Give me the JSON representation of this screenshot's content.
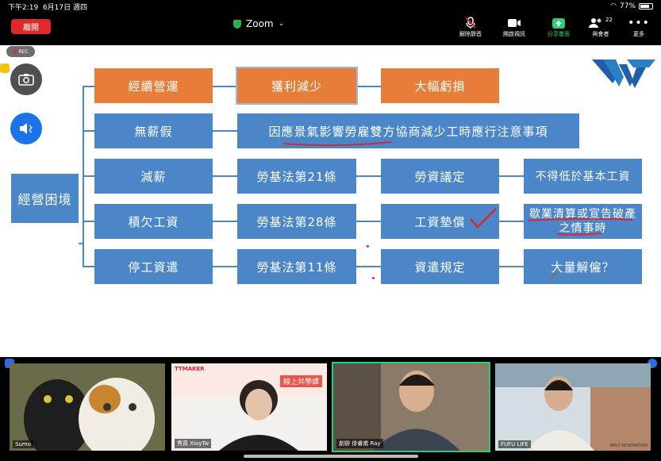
{
  "status_bar": {
    "time": "下午2:19",
    "date": "6月17日 週四",
    "battery": "77%"
  },
  "toolbar": {
    "leave_label": "離開",
    "title": "Zoom",
    "unmute_label": "解除靜音",
    "video_label": "開啟視訊",
    "share_label": "分享畫面",
    "participants_label": "與會者",
    "participants_count": "22",
    "more_label": "更多"
  },
  "side": {
    "rec_label": "REC",
    "camera_label": "切換攝影機",
    "bt_label": "藍牙"
  },
  "slide": {
    "root": "經營困境",
    "rows": [
      {
        "c1": "經續營運",
        "c2": "獲利減少",
        "c3": "大幅虧損"
      },
      {
        "c1": "無薪假",
        "c2": "因應景氣影響勞雇雙方協商減少工時應行注意事項"
      },
      {
        "c1": "減薪",
        "c2": "勞基法第21條",
        "c3": "勞資議定",
        "c4": "不得低於基本工資"
      },
      {
        "c1": "積欠工資",
        "c2": "勞基法第28條",
        "c3": "工資墊償",
        "c4a": "歇業清算或宣告破產",
        "c4b": "之情事時"
      },
      {
        "c1": "停工資遣",
        "c2": "勞基法第11條",
        "c3": "資遣規定",
        "c4": "大量解僱？"
      }
    ]
  },
  "participants": [
    {
      "name": "Sumo"
    },
    {
      "name": "秀真 XioyTw",
      "banner_brand": "TTMAKER",
      "banner_title": "線上共學課"
    },
    {
      "name": "創辦 徐睿甫 Ray"
    },
    {
      "name": "FUFU LIFE",
      "watermark": "WILD RENOVATION"
    }
  ]
}
